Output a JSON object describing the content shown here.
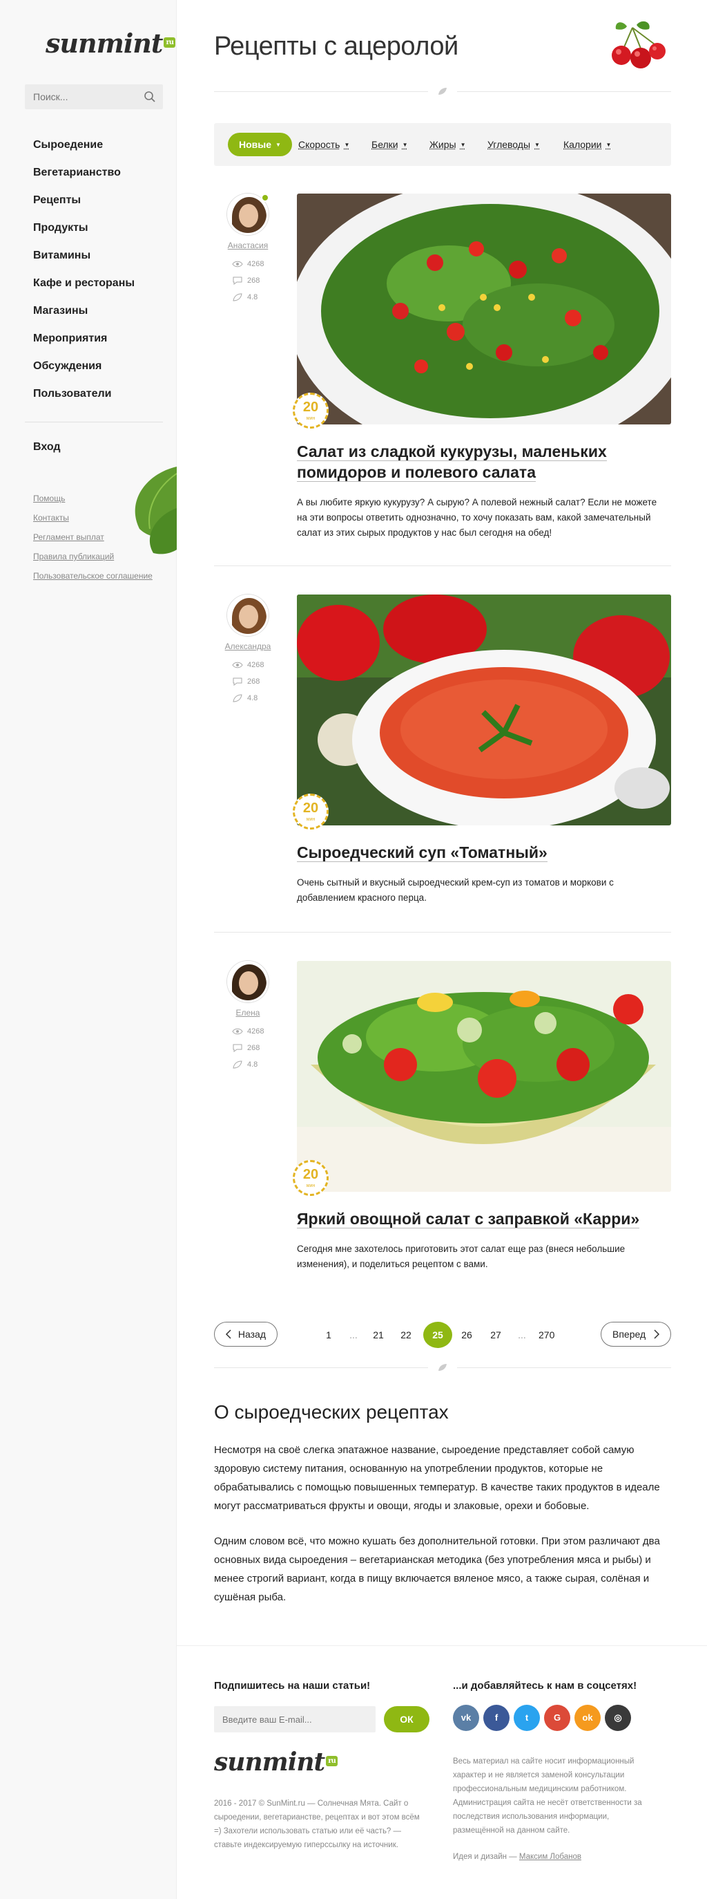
{
  "sidebar": {
    "logo": "sunmint",
    "logo_badge": "ru",
    "search_placeholder": "Поиск...",
    "nav": [
      "Сыроедение",
      "Вегетарианство",
      "Рецепты",
      "Продукты",
      "Витамины",
      "Кафе и рестораны",
      "Магазины",
      "Мероприятия",
      "Обсуждения",
      "Пользователи"
    ],
    "login": "Вход",
    "links": [
      "Помощь",
      "Контакты",
      "Регламент выплат",
      "Правила публикаций",
      "Пользовательское соглашение"
    ]
  },
  "page": {
    "title": "Рецепты с ацеролой"
  },
  "filters": [
    {
      "label": "Новые",
      "active": true
    },
    {
      "label": "Скорость",
      "active": false
    },
    {
      "label": "Белки",
      "active": false
    },
    {
      "label": "Жиры",
      "active": false
    },
    {
      "label": "Углеводы",
      "active": false
    },
    {
      "label": "Калории",
      "active": false
    }
  ],
  "posts": [
    {
      "author": "Анастасия",
      "views": "4268",
      "comments": "268",
      "rating": "4.8",
      "time": "20",
      "time_unit": "мин",
      "title": "Салат из сладкой кукурузы, маленьких помидоров и полевого салата",
      "excerpt": "А вы любите яркую кукурузу? А сырую? А полевой нежный салат? Если не можете на эти вопросы ответить однозначно, то хочу показать вам, какой замечательный салат из этих сырых продуктов у нас был сегодня на обед!"
    },
    {
      "author": "Александра",
      "views": "4268",
      "comments": "268",
      "rating": "4.8",
      "time": "20",
      "time_unit": "мин",
      "title": "Сыроедческий суп «Томатный»",
      "excerpt": "Очень сытный и вкусный сыроедческий крем-суп из томатов и моркови с добавлением красного перца."
    },
    {
      "author": "Елена",
      "views": "4268",
      "comments": "268",
      "rating": "4.8",
      "time": "20",
      "time_unit": "мин",
      "title": "Яркий овощной салат с заправкой «Карри»",
      "excerpt": "Сегодня мне захотелось приготовить этот салат еще раз (внеся небольшие изменения), и поделиться рецептом с вами."
    }
  ],
  "pagination": {
    "prev": "Назад",
    "next": "Вперед",
    "pages": [
      "1",
      "...",
      "21",
      "22",
      "25",
      "26",
      "27",
      "...",
      "270"
    ],
    "current": "25"
  },
  "about": {
    "title": "О сыроедческих рецептах",
    "p1": "Несмотря на своё слегка эпатажное название, сыроедение представляет собой самую здоровую систему питания, основанную на употреблении продуктов, которые не обрабатывались с помощью повышенных температур. В качестве таких продуктов в идеале могут рассматриваться фрукты и овощи, ягоды и злаковые, орехи и бобовые.",
    "p2": "Одним словом всё, что можно кушать без дополнительной готовки. При этом различают два основных вида сыроедения – вегетарианская методика (без употребления мяса и рыбы) и менее строгий вариант, когда в пищу включается вяленое мясо, а также сырая, солёная и сушёная рыба."
  },
  "footer": {
    "subscribe_title": "Подпишитесь на наши статьи!",
    "email_placeholder": "Введите ваш E-mail...",
    "ok": "ОК",
    "social_title": "...и добавляйтесь к нам в соцсетях!",
    "socials": [
      {
        "name": "vk",
        "glyph": "vk",
        "color": "#5b7fa6"
      },
      {
        "name": "facebook",
        "glyph": "f",
        "color": "#3b5998"
      },
      {
        "name": "twitter",
        "glyph": "t",
        "color": "#2aa3ef"
      },
      {
        "name": "google-plus",
        "glyph": "G",
        "color": "#dc4a38"
      },
      {
        "name": "odnoklassniki",
        "glyph": "ok",
        "color": "#f59a1e"
      },
      {
        "name": "instagram",
        "glyph": "◎",
        "color": "#3a3a3a"
      }
    ],
    "logo": "sunmint",
    "logo_badge": "ru",
    "copyright": "2016 - 2017 © SunMint.ru — Солнечная Мята. Сайт о сыроедении, вегетарианстве, рецептах и вот этом всём =) Захотели использовать статью или её часть? — ставьте индексируемую гиперссылку на источник.",
    "disclaimer": "Весь материал на сайте носит информационный характер и не является заменой консультации профессиональным медицинским работником. Администрация сайта не несёт ответственности за последствия использования информации, размещённой на данном сайте.",
    "credit_prefix": "Идея и дизайн — ",
    "credit_name": "Максим Лобанов"
  },
  "colors": {
    "accent": "#8fb813",
    "timer": "#e3b423"
  }
}
